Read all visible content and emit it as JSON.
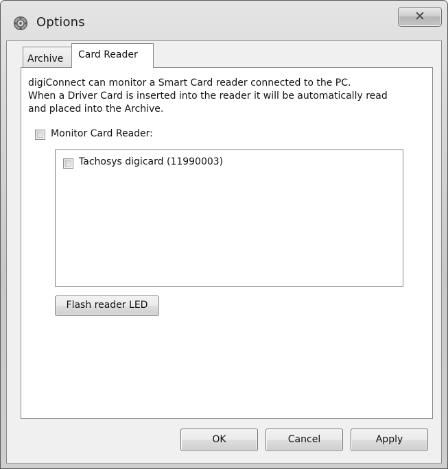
{
  "window": {
    "title": "Options",
    "close_symbol": "✕"
  },
  "tabs": [
    {
      "label": "Archive",
      "selected": false
    },
    {
      "label": "Card Reader",
      "selected": true
    }
  ],
  "card_reader": {
    "description_lines": [
      "digiConnect can monitor a Smart Card reader connected to the PC.",
      "When a Driver Card is inserted into the reader it will be automatically read",
      "and placed into the Archive."
    ],
    "monitor_checkbox": {
      "label": "Monitor Card Reader:",
      "checked": false
    },
    "readers": [
      {
        "label": "Tachosys digicard (11990003)",
        "checked": false
      }
    ],
    "flash_button_label": "Flash reader LED"
  },
  "footer": {
    "ok_label": "OK",
    "cancel_label": "Cancel",
    "apply_label": "Apply"
  },
  "icons": {
    "app_icon": "gear-options-icon",
    "close_icon": "close-icon"
  }
}
